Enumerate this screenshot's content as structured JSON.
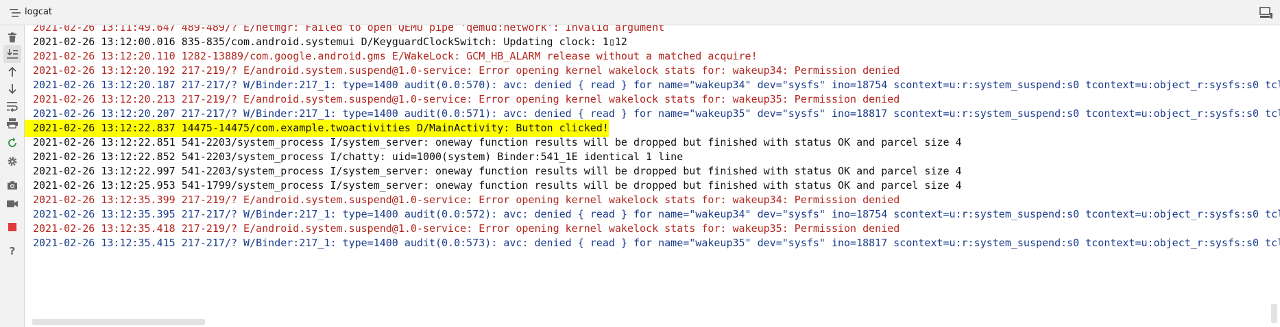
{
  "window": {
    "title": "logcat"
  },
  "colors": {
    "error": "#b3261e",
    "warning": "#1a3c8c",
    "info": "#111111",
    "highlight": "#ffff00",
    "restart_green": "#3a9a4a",
    "stop_red": "#e03a3a"
  },
  "toolbar": {
    "items": [
      {
        "icon": "trash-icon"
      },
      {
        "icon": "scroll-to-end-icon"
      },
      {
        "icon": "up-arrow-icon"
      },
      {
        "icon": "down-arrow-icon"
      },
      {
        "icon": "soft-wrap-icon"
      },
      {
        "icon": "print-icon"
      },
      {
        "icon": "restart-icon"
      },
      {
        "icon": "settings-icon"
      },
      {
        "icon": "camera-icon"
      },
      {
        "icon": "video-icon"
      },
      {
        "icon": "stop-icon"
      },
      {
        "icon": "help-icon"
      }
    ]
  },
  "log": {
    "lines": [
      {
        "level": "E",
        "text": "2021-02-26 13:11:49.647 489-489/? E/netmgr: Failed to open QEMU pipe 'qemud:network': Invalid argument"
      },
      {
        "level": "D",
        "text": "2021-02-26 13:12:00.016 835-835/com.android.systemui D/KeyguardClockSwitch: Updating clock: 1▯12"
      },
      {
        "level": "E",
        "text": "2021-02-26 13:12:20.110 1282-13889/com.google.android.gms E/WakeLock: GCM_HB_ALARM release without a matched acquire!"
      },
      {
        "level": "E",
        "text": "2021-02-26 13:12:20.192 217-219/? E/android.system.suspend@1.0-service: Error opening kernel wakelock stats for: wakeup34: Permission denied"
      },
      {
        "level": "W",
        "text": "2021-02-26 13:12:20.187 217-217/? W/Binder:217_1: type=1400 audit(0.0:570): avc: denied { read } for name=\"wakeup34\" dev=\"sysfs\" ino=18754 scontext=u:r:system_suspend:s0 tcontext=u:object_r:sysfs:s0 tcl"
      },
      {
        "level": "E",
        "text": "2021-02-26 13:12:20.213 217-219/? E/android.system.suspend@1.0-service: Error opening kernel wakelock stats for: wakeup35: Permission denied"
      },
      {
        "level": "W",
        "text": "2021-02-26 13:12:20.207 217-217/? W/Binder:217_1: type=1400 audit(0.0:571): avc: denied { read } for name=\"wakeup35\" dev=\"sysfs\" ino=18817 scontext=u:r:system_suspend:s0 tcontext=u:object_r:sysfs:s0 tcl"
      },
      {
        "level": "D",
        "text": "2021-02-26 13:12:22.837 14475-14475/com.example.twoactivities D/MainActivity: Button clicked!",
        "highlighted": true
      },
      {
        "level": "I",
        "text": "2021-02-26 13:12:22.851 541-2203/system_process I/system_server: oneway function results will be dropped but finished with status OK and parcel size 4"
      },
      {
        "level": "I",
        "text": "2021-02-26 13:12:22.852 541-2203/system_process I/chatty: uid=1000(system) Binder:541_1E identical 1 line"
      },
      {
        "level": "I",
        "text": "2021-02-26 13:12:22.997 541-2203/system_process I/system_server: oneway function results will be dropped but finished with status OK and parcel size 4"
      },
      {
        "level": "I",
        "text": "2021-02-26 13:12:25.953 541-1799/system_process I/system_server: oneway function results will be dropped but finished with status OK and parcel size 4"
      },
      {
        "level": "E",
        "text": "2021-02-26 13:12:35.399 217-219/? E/android.system.suspend@1.0-service: Error opening kernel wakelock stats for: wakeup34: Permission denied"
      },
      {
        "level": "W",
        "text": "2021-02-26 13:12:35.395 217-217/? W/Binder:217_1: type=1400 audit(0.0:572): avc: denied { read } for name=\"wakeup34\" dev=\"sysfs\" ino=18754 scontext=u:r:system_suspend:s0 tcontext=u:object_r:sysfs:s0 tcl"
      },
      {
        "level": "E",
        "text": "2021-02-26 13:12:35.418 217-219/? E/android.system.suspend@1.0-service: Error opening kernel wakelock stats for: wakeup35: Permission denied"
      },
      {
        "level": "W",
        "text": "2021-02-26 13:12:35.415 217-217/? W/Binder:217_1: type=1400 audit(0.0:573): avc: denied { read } for name=\"wakeup35\" dev=\"sysfs\" ino=18817 scontext=u:r:system_suspend:s0 tcontext=u:object_r:sysfs:s0 tcl"
      }
    ]
  }
}
